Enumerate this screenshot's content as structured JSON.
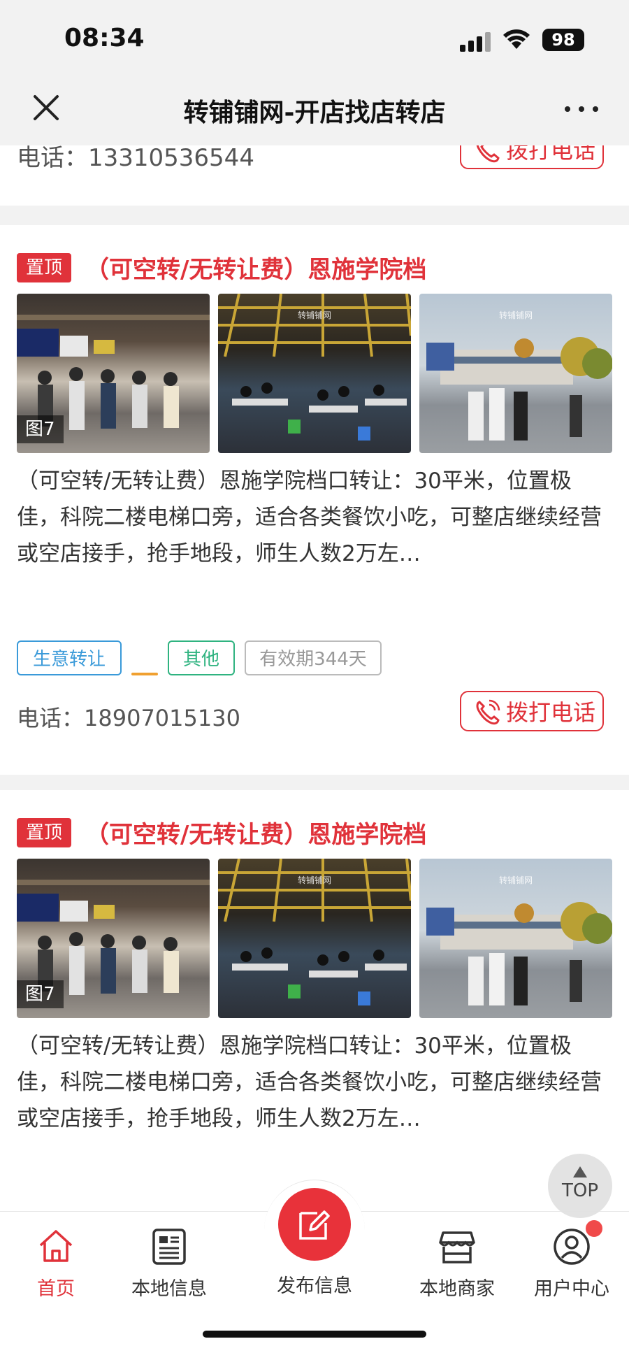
{
  "status_bar": {
    "time": "08:34",
    "battery": "98"
  },
  "top_bar": {
    "title": "转铺铺网-开店找店转店"
  },
  "partial_card": {
    "phone": "电话：13310536544",
    "call_label": "拨打电话"
  },
  "posts": [
    {
      "badge": "置顶",
      "title": "（可空转/无转让费）恩施学院档",
      "photo_count": "图7",
      "watermark": "转铺铺网",
      "description": "（可空转/无转让费）恩施学院档口转让：30平米，位置极佳，科院二楼电梯口旁，适合各类餐饮小吃，可整店继续经营或空店接手，抢手地段，师生人数2万左…",
      "tags": {
        "category": "生意转让",
        "type": "其他",
        "validity": "有效期344天"
      },
      "phone": "电话：18907015130",
      "call_label": "拨打电话"
    },
    {
      "badge": "置顶",
      "title": "（可空转/无转让费）恩施学院档",
      "photo_count": "图7",
      "watermark": "转铺铺网",
      "description": "（可空转/无转让费）恩施学院档口转让：30平米，位置极佳，科院二楼电梯口旁，适合各类餐饮小吃，可整店继续经营或空店接手，抢手地段，师生人数2万左…"
    }
  ],
  "top_button": {
    "label": "TOP"
  },
  "bottom_nav": {
    "items": [
      {
        "label": "首页",
        "icon": "home-icon",
        "active": true
      },
      {
        "label": "本地信息",
        "icon": "news-icon"
      },
      {
        "label": "发布信息",
        "icon": "edit-icon"
      },
      {
        "label": "本地商家",
        "icon": "store-icon"
      },
      {
        "label": "用户中心",
        "icon": "user-icon"
      }
    ]
  },
  "colors": {
    "accent": "#e0323a",
    "tag_blue": "#3a9ad9",
    "tag_green": "#2fb380"
  }
}
